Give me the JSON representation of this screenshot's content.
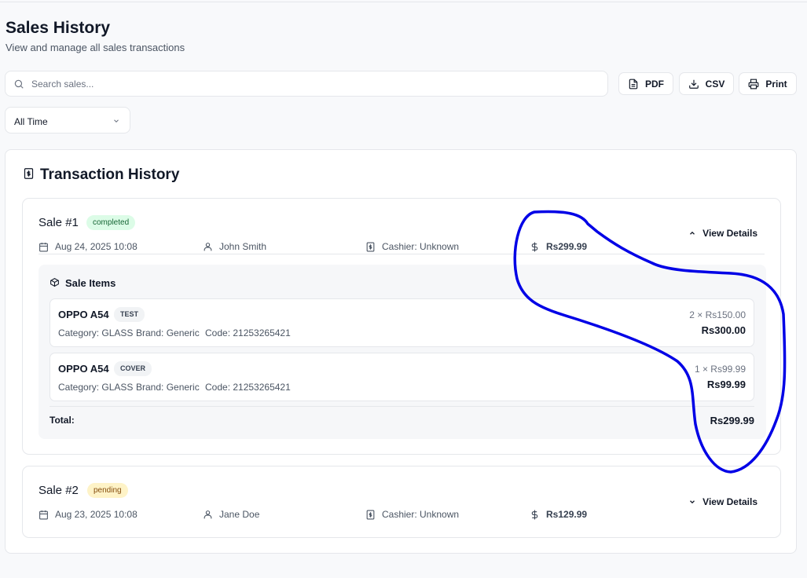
{
  "header": {
    "title": "Sales History",
    "subtitle": "View and manage all sales transactions"
  },
  "search": {
    "placeholder": "Search sales...",
    "value": ""
  },
  "toolbar": {
    "pdf_label": "PDF",
    "csv_label": "CSV",
    "print_label": "Print"
  },
  "filter": {
    "selected": "All Time"
  },
  "transactions": {
    "title": "Transaction History",
    "sales": [
      {
        "name": "Sale #1",
        "status": "completed",
        "date": "Aug 24, 2025 10:08",
        "customer": "John Smith",
        "cashier": "Cashier: Unknown",
        "amount": "Rs299.99",
        "toggle_label": "View Details",
        "expanded": true,
        "items_title": "Sale Items",
        "items": [
          {
            "name": "OPPO A54",
            "tag": "TEST",
            "category": "Category: GLASS",
            "brand": "Brand: Generic",
            "code": "Code: 21253265421",
            "qty_price": "2 × Rs150.00",
            "subtotal": "Rs300.00"
          },
          {
            "name": "OPPO A54",
            "tag": "COVER",
            "category": "Category: GLASS",
            "brand": "Brand: Generic",
            "code": "Code: 21253265421",
            "qty_price": "1 × Rs99.99",
            "subtotal": "Rs99.99"
          }
        ],
        "total_label": "Total:",
        "total_value": "Rs299.99"
      },
      {
        "name": "Sale #2",
        "status": "pending",
        "date": "Aug 23, 2025 10:08",
        "customer": "Jane Doe",
        "cashier": "Cashier: Unknown",
        "amount": "Rs129.99",
        "toggle_label": "View Details",
        "expanded": false
      }
    ]
  },
  "colors": {
    "completed_badge_bg": "#dcfce7",
    "completed_badge_text": "#166534",
    "pending_badge_bg": "#fef3c7",
    "pending_badge_text": "#854d0e",
    "annotation_stroke": "#0000e6"
  },
  "icons": [
    "search-icon",
    "file-icon",
    "download-icon",
    "printer-icon",
    "chevron-down-icon",
    "receipt-icon",
    "calendar-icon",
    "user-icon",
    "dollar-icon",
    "chevron-up-icon",
    "package-icon"
  ]
}
